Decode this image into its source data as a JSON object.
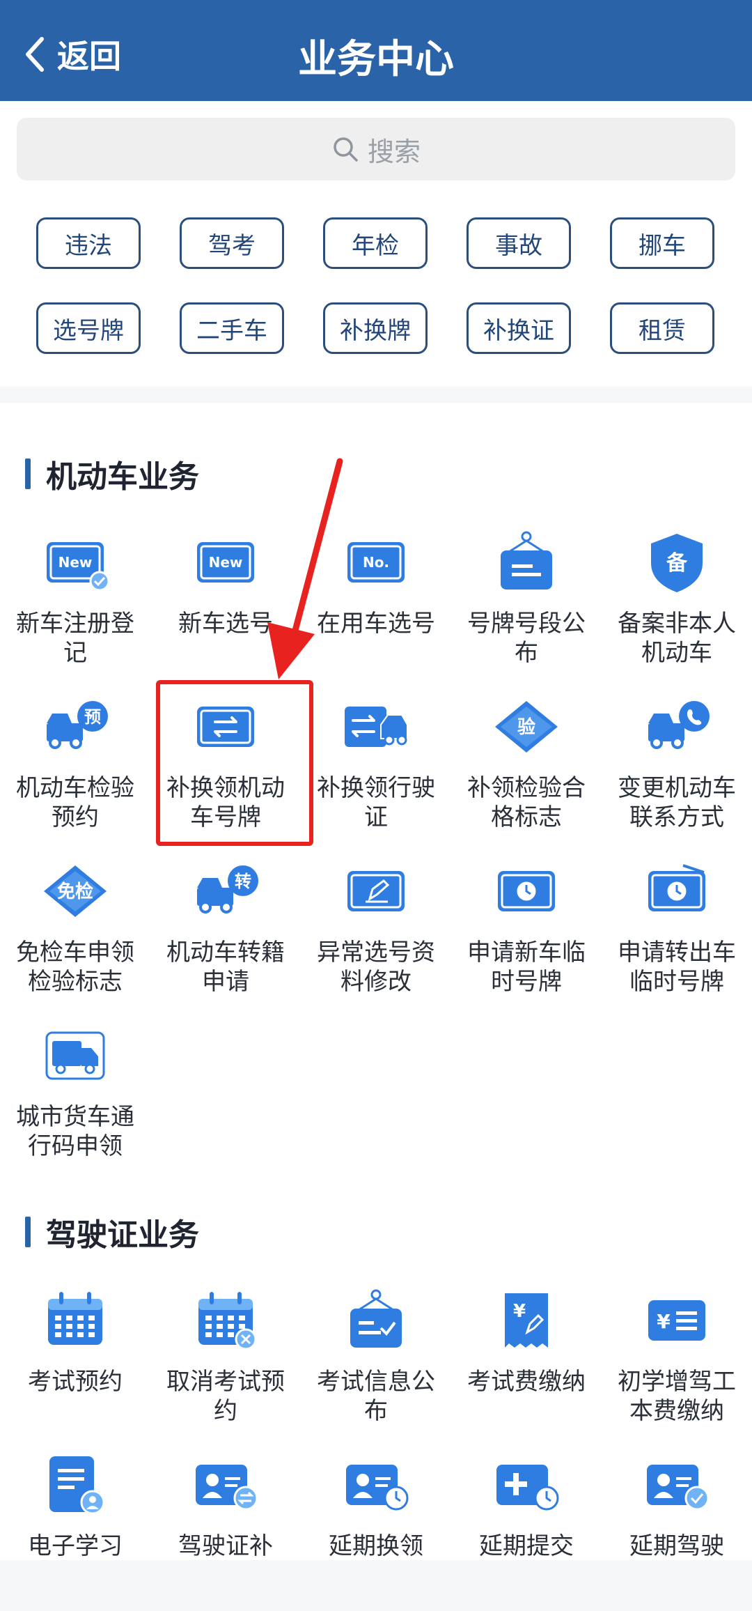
{
  "header": {
    "back_label": "返回",
    "title": "业务中心"
  },
  "search": {
    "placeholder": "搜索"
  },
  "quick_chips": [
    "违法",
    "驾考",
    "年检",
    "事故",
    "挪车",
    "选号牌",
    "二手车",
    "补换牌",
    "补换证",
    "租赁"
  ],
  "motor_vehicle": {
    "title": "机动车业务",
    "items": [
      {
        "label": "新车注册登记",
        "icon": "new-plate-check-icon"
      },
      {
        "label": "新车选号",
        "icon": "new-plate-icon"
      },
      {
        "label": "在用车选号",
        "icon": "no-plate-icon"
      },
      {
        "label": "号牌号段公布",
        "icon": "sign-board-icon"
      },
      {
        "label": "备案非本人机动车",
        "icon": "shield-record-icon"
      },
      {
        "label": "机动车检验预约",
        "icon": "truck-reserve-icon"
      },
      {
        "label": "补换领机动车号牌",
        "icon": "plate-swap-icon"
      },
      {
        "label": "补换领行驶证",
        "icon": "license-swap-icon"
      },
      {
        "label": "补领检验合格标志",
        "icon": "inspection-diamond-icon"
      },
      {
        "label": "变更机动车联系方式",
        "icon": "truck-phone-icon"
      },
      {
        "label": "免检车申领检验标志",
        "icon": "exempt-diamond-icon"
      },
      {
        "label": "机动车转籍申请",
        "icon": "truck-transfer-icon"
      },
      {
        "label": "异常选号资料修改",
        "icon": "plate-edit-icon"
      },
      {
        "label": "申请新车临时号牌",
        "icon": "plate-clock-icon"
      },
      {
        "label": "申请转出车临时号牌",
        "icon": "plate-clock-radio-icon"
      },
      {
        "label": "城市货车通行码申领",
        "icon": "truck-pass-icon"
      }
    ]
  },
  "driver_license": {
    "title": "驾驶证业务",
    "items": [
      {
        "label": "考试预约",
        "icon": "calendar-icon"
      },
      {
        "label": "取消考试预约",
        "icon": "calendar-cancel-icon"
      },
      {
        "label": "考试信息公布",
        "icon": "sign-check-icon"
      },
      {
        "label": "考试费缴纳",
        "icon": "receipt-yen-icon"
      },
      {
        "label": "初学增驾工本费缴纳",
        "icon": "card-yen-icon"
      },
      {
        "label": "电子学习",
        "icon": "doc-user-icon"
      },
      {
        "label": "驾驶证补",
        "icon": "id-swap-icon"
      },
      {
        "label": "延期换领",
        "icon": "id-clock-icon"
      },
      {
        "label": "延期提交",
        "icon": "plus-clock-icon"
      },
      {
        "label": "延期驾驶",
        "icon": "id-check-icon"
      }
    ]
  },
  "colors": {
    "header": "#2b63a8",
    "accent": "#2f7de1",
    "highlight": "#e8231f"
  }
}
